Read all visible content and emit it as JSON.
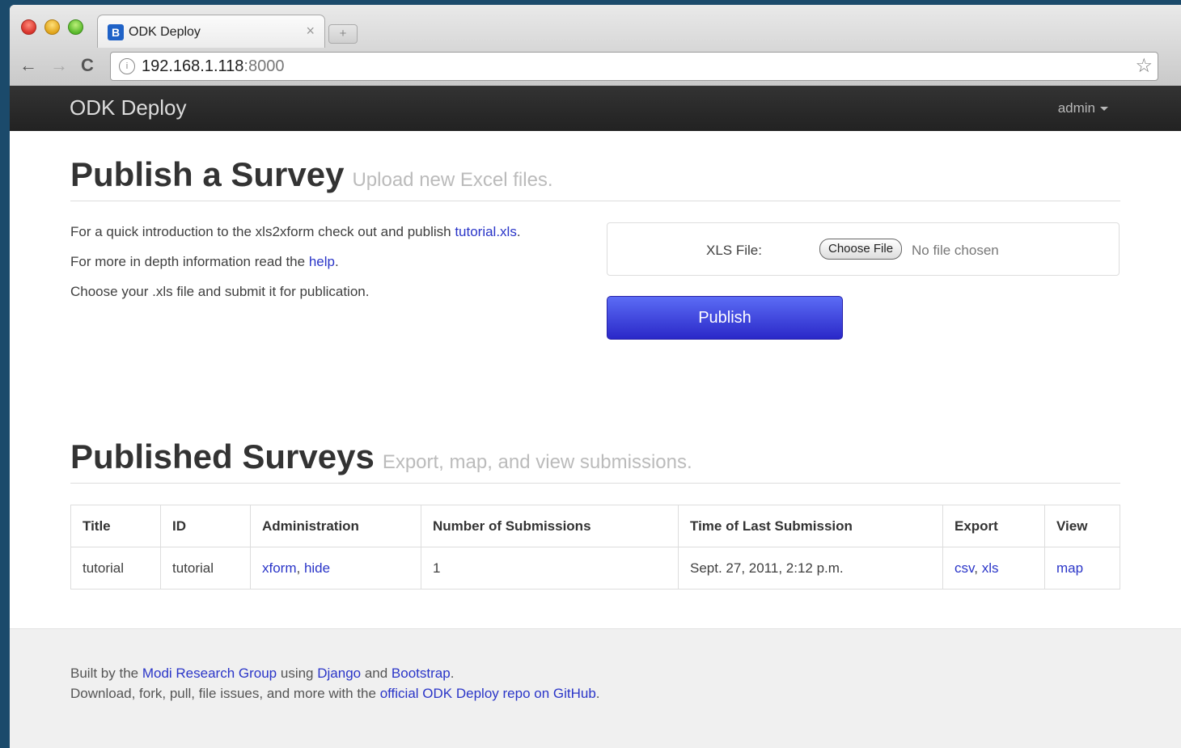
{
  "browser": {
    "tab_title": "ODK Deploy",
    "tab_favicon": "B",
    "tab_close": "×",
    "new_tab": "+",
    "url_host": "192.168.1.118",
    "url_port": ":8000",
    "back_icon": "←",
    "forward_icon": "→",
    "reload_icon": "C",
    "star_icon": "☆"
  },
  "navbar": {
    "brand": "ODK Deploy",
    "user": "admin"
  },
  "publish": {
    "title": "Publish a Survey",
    "subtitle": "Upload new Excel files.",
    "intro1_pre": "For a quick introduction to the xls2xform check out and publish ",
    "intro1_link": "tutorial.xls",
    "intro1_post": ".",
    "intro2_pre": "For more in depth information read the ",
    "intro2_link": "help",
    "intro2_post": ".",
    "intro3": "Choose your .xls file and submit it for publication.",
    "file_label": "XLS File:",
    "choose_file": "Choose File",
    "no_file": "No file chosen",
    "button": "Publish"
  },
  "published": {
    "title": "Published Surveys",
    "subtitle": "Export, map, and view submissions.",
    "columns": [
      "Title",
      "ID",
      "Administration",
      "Number of Submissions",
      "Time of Last Submission",
      "Export",
      "View"
    ],
    "rows": [
      {
        "title": "tutorial",
        "id": "tutorial",
        "admin_xform": "xform",
        "admin_sep": ", ",
        "admin_hide": "hide",
        "submissions": "1",
        "last_submission": "Sept. 27, 2011, 2:12 p.m.",
        "export_csv": "csv",
        "export_sep": ", ",
        "export_xls": "xls",
        "view": "map"
      }
    ]
  },
  "footer": {
    "line1_a": "Built by the ",
    "line1_link1": "Modi Research Group",
    "line1_b": " using ",
    "line1_link2": "Django",
    "line1_c": " and ",
    "line1_link3": "Bootstrap",
    "line1_d": ".",
    "line2_a": "Download, fork, pull, file issues, and more with the ",
    "line2_link": "official ODK Deploy repo on GitHub",
    "line2_b": "."
  },
  "colors": {
    "link": "#2a35c8",
    "navbar": "#222222",
    "publish_button": "#3a3ad8"
  }
}
